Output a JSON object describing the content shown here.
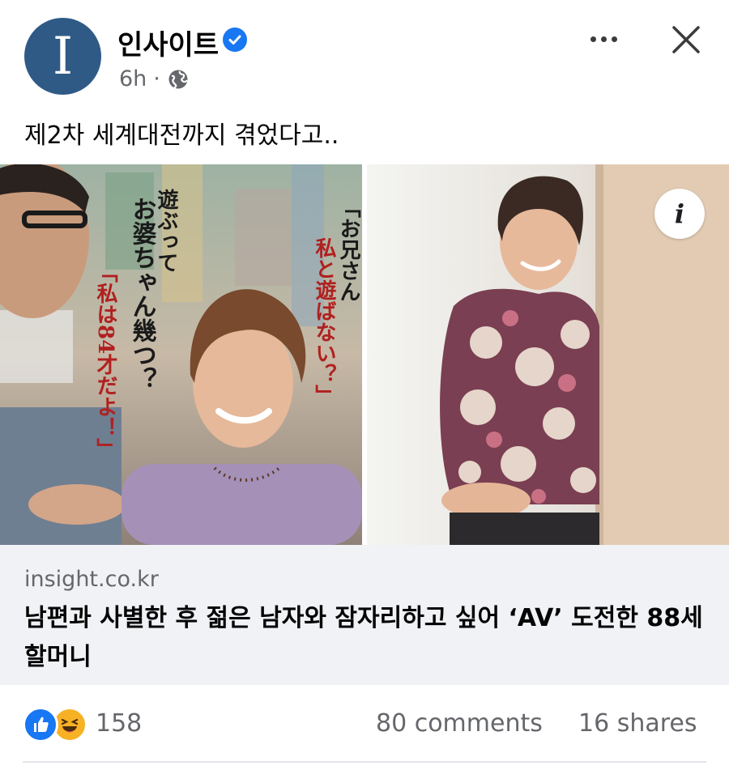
{
  "post": {
    "page_name": "인사이트",
    "avatar_letter": "I",
    "time": "6h",
    "separator": "·",
    "privacy_icon": "globe-icon",
    "verified_icon": "verified-badge-icon",
    "more_icon": "more-options-icon",
    "close_icon": "close-icon",
    "caption": "제2차 세계대전까지 겪었다고..",
    "brand_color": "#1877f2"
  },
  "media": {
    "info_label": "i",
    "left_panel_text": [
      "遊ぶって",
      "お婆ちゃん幾つ？",
      "「私は84才だよ！」",
      "「お兄さん",
      "私と遊ばない？」"
    ]
  },
  "link": {
    "domain": "insight.co.kr",
    "headline": "남편과 사별한 후 젊은 남자와 잠자리하고 싶어 ‘AV’ 도전한 88세 할머니"
  },
  "engagement": {
    "reaction_icons": [
      "like-icon",
      "haha-icon"
    ],
    "reaction_count": "158",
    "comments": "80 comments",
    "shares": "16 shares"
  }
}
